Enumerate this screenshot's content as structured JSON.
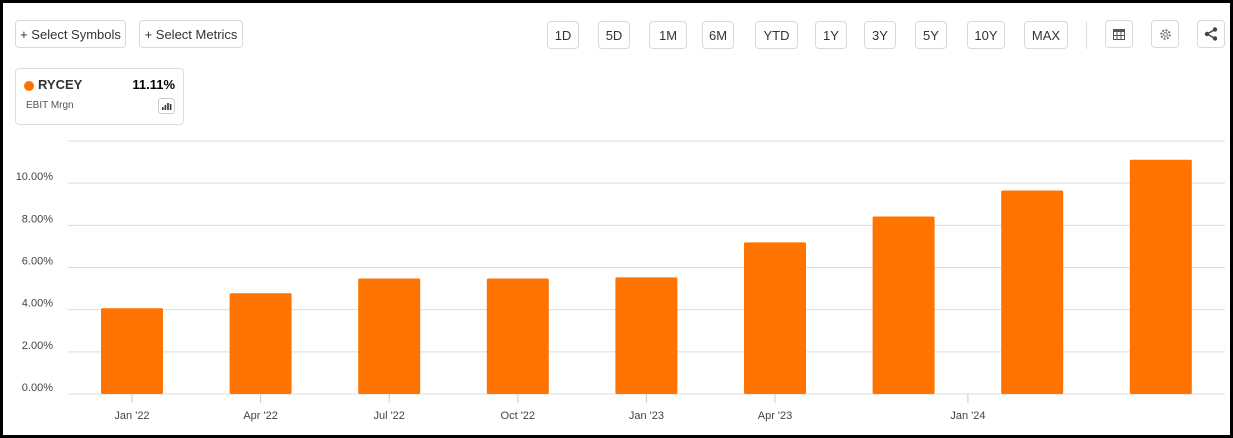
{
  "toolbar": {
    "select_symbols": "+ Select Symbols",
    "select_metrics": "+ Select Metrics",
    "ranges": [
      "1D",
      "5D",
      "1M",
      "6M",
      "YTD",
      "1Y",
      "3Y",
      "5Y",
      "10Y",
      "MAX"
    ],
    "icons": [
      "table-icon",
      "gear-icon",
      "share-icon"
    ]
  },
  "legend_card": {
    "symbol": "RYCEY",
    "value": "11.11%",
    "metric": "EBIT Mrgn",
    "color": "#ff7400"
  },
  "chart_data": {
    "type": "bar",
    "series": [
      {
        "name": "RYCEY EBIT Mrgn",
        "color": "#ff7400",
        "values": [
          4.07,
          4.78,
          5.48,
          5.48,
          5.53,
          7.19,
          8.42,
          9.65,
          11.11
        ]
      }
    ],
    "ylim": [
      0,
      12
    ],
    "yticks": [
      0,
      2,
      4,
      6,
      8,
      10,
      12
    ],
    "ytick_labels": [
      "0.00%",
      "2.00%",
      "4.00%",
      "6.00%",
      "8.00%",
      "10.00%",
      ""
    ],
    "xtick_labels": [
      {
        "label": "Jan '22",
        "index": 0
      },
      {
        "label": "Apr '22",
        "index": 1
      },
      {
        "label": "Jul '22",
        "index": 2
      },
      {
        "label": "Oct '22",
        "index": 3
      },
      {
        "label": "Jan '23",
        "index": 4
      },
      {
        "label": "Apr '23",
        "index": 5
      },
      {
        "label": "Jan '24",
        "index": 6.5
      }
    ],
    "grid": true,
    "title": "",
    "xlabel": "",
    "ylabel": ""
  }
}
